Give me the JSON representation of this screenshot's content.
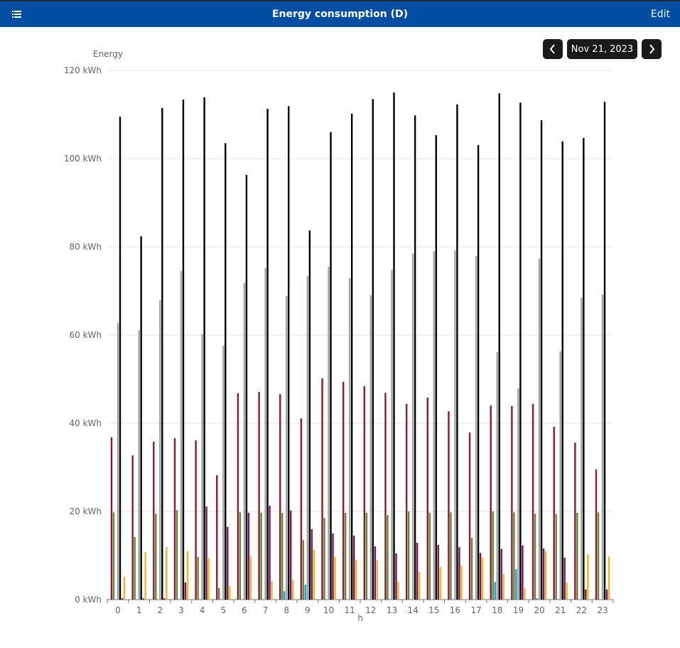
{
  "header": {
    "title": "Energy consumption (D)",
    "edit_label": "Edit",
    "menu_icon": "menu-icon"
  },
  "date_nav": {
    "date": "Nov 21, 2023",
    "prev_icon": "chevron-left-icon",
    "next_icon": "chevron-right-icon"
  },
  "chart_data": {
    "type": "bar",
    "title": "",
    "ylabel": "Energy",
    "xlabel": "h",
    "ylim": [
      0,
      120
    ],
    "yticks": [
      "0 kWh",
      "20 kWh",
      "40 kWh",
      "60 kWh",
      "80 kWh",
      "100 kWh",
      "120 kWh"
    ],
    "ytick_values": [
      0,
      20,
      40,
      60,
      80,
      100,
      120
    ],
    "grid": true,
    "categories": [
      "0",
      "1",
      "2",
      "3",
      "4",
      "5",
      "6",
      "7",
      "8",
      "9",
      "10",
      "11",
      "12",
      "13",
      "14",
      "15",
      "16",
      "17",
      "18",
      "19",
      "20",
      "21",
      "22",
      "23"
    ],
    "series": [
      {
        "name": "series-darkred",
        "color": "#8b1a2a",
        "values": [
          36.8,
          32.7,
          35.8,
          36.6,
          36.1,
          28.2,
          46.8,
          47.1,
          46.6,
          41.1,
          50.2,
          49.4,
          48.4,
          46.9,
          44.4,
          45.8,
          42.7,
          37.9,
          44.0,
          43.9,
          44.4,
          39.2,
          35.6,
          29.5
        ]
      },
      {
        "name": "series-green",
        "color": "#5a8a3c",
        "values": [
          19.8,
          14.2,
          19.5,
          20.3,
          9.7,
          2.6,
          19.8,
          19.7,
          19.7,
          13.5,
          18.5,
          19.7,
          19.7,
          19.2,
          20.0,
          19.7,
          19.8,
          14.0,
          20.0,
          19.8,
          19.5,
          19.4,
          19.7,
          19.8
        ]
      },
      {
        "name": "series-cyan",
        "color": "#1b9ad6",
        "values": [
          0,
          0,
          0,
          0,
          0,
          0,
          0,
          0,
          1.9,
          3.4,
          0,
          0,
          0,
          0,
          0,
          0,
          0,
          0,
          4.0,
          6.9,
          0.3,
          0,
          0,
          0
        ]
      },
      {
        "name": "series-gray",
        "color": "#a3a3a3",
        "values": [
          62.7,
          61.1,
          67.9,
          74.5,
          60.2,
          57.6,
          71.8,
          75.2,
          68.9,
          73.4,
          75.5,
          72.9,
          69.0,
          74.8,
          78.5,
          79.0,
          79.2,
          77.9,
          56.1,
          47.9,
          77.3,
          56.3,
          68.5,
          69.2
        ]
      },
      {
        "name": "series-black",
        "color": "#000000",
        "values": [
          109.5,
          82.4,
          111.5,
          113.4,
          113.9,
          103.5,
          96.3,
          111.3,
          111.9,
          83.7,
          106.0,
          110.2,
          113.5,
          115.0,
          109.8,
          105.3,
          112.3,
          103.1,
          114.8,
          112.7,
          108.7,
          103.9,
          104.7,
          112.9
        ]
      },
      {
        "name": "series-purple",
        "color": "#7b1557",
        "values": [
          0.3,
          0.3,
          0.3,
          3.9,
          21.1,
          16.5,
          19.7,
          21.3,
          20.2,
          16.0,
          15.0,
          14.5,
          12.1,
          10.5,
          12.9,
          12.4,
          11.9,
          10.6,
          11.5,
          12.3,
          11.6,
          9.5,
          2.3,
          2.3
        ]
      },
      {
        "name": "series-orange",
        "color": "#f0b429",
        "values": [
          5.2,
          10.8,
          11.9,
          11.0,
          9.4,
          3.1,
          9.8,
          4.2,
          4.5,
          11.3,
          9.7,
          9.0,
          8.9,
          4.0,
          6.3,
          7.4,
          7.7,
          9.5,
          5.8,
          2.6,
          11.0,
          3.9,
          10.3,
          9.8
        ]
      }
    ]
  }
}
